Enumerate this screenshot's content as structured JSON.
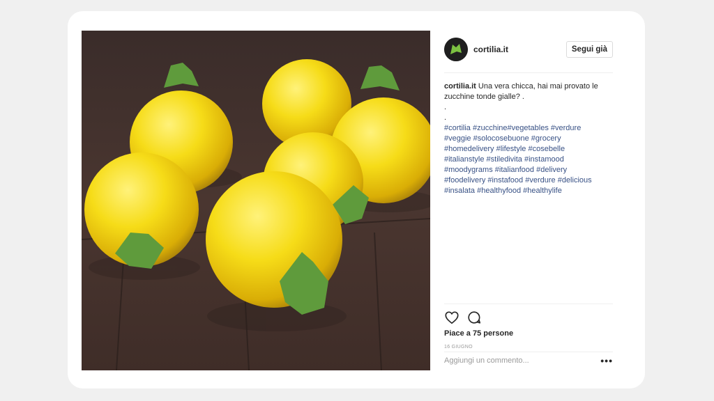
{
  "post": {
    "username": "cortilia.it",
    "follow_label": "Segui già",
    "caption_user": "cortilia.it",
    "caption_text": "Una vera chicca, hai mai provato le zucchine tonde gialle? .",
    "caption_dots": [
      ".",
      "."
    ],
    "hashtags": [
      "#cortilia",
      "#zucchine",
      "#vegetables",
      "#verdure",
      "#veggie",
      "#solocosebuone",
      "#grocery",
      "#homedelivery",
      "#lifestyle",
      "#cosebelle",
      "#italianstyle",
      "#stiledivita",
      "#instamood",
      "#moodygrams",
      "#italianfood",
      "#delivery",
      "#foodelivery",
      "#instafood",
      "#verdure",
      "#delicious",
      "#insalata",
      "#healthyfood",
      "#healthylife"
    ],
    "likes_text": "Piace a 75 persone",
    "date_text": "16 GIUGNO",
    "comment_placeholder": "Aggiungi un commento...",
    "more_label": "•••"
  },
  "icons": {
    "like": "heart-icon",
    "comment": "comment-bubble-icon",
    "avatar": "cortilia-logo-icon"
  },
  "colors": {
    "hashtag": "#385185",
    "text": "#262626",
    "background": "#f0f0f0"
  }
}
